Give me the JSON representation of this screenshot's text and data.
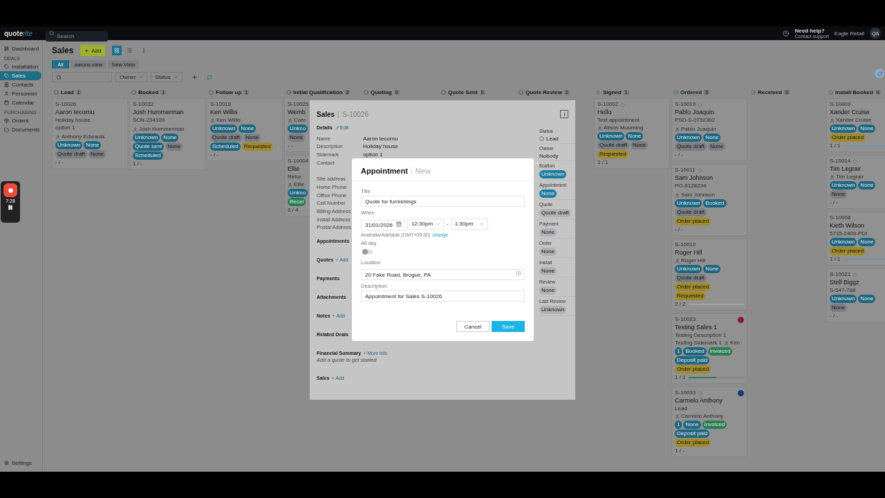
{
  "topbar": {
    "brand": [
      "quote",
      "rite"
    ],
    "search": {
      "placeholder": "Search"
    },
    "help": {
      "title": "Need help?",
      "subtitle": "Contact support"
    },
    "company": "Eagle Retail",
    "avatar": "QA"
  },
  "sidebar": {
    "groups": [
      {
        "items": [
          {
            "label": "Dashboard",
            "selected": false
          }
        ]
      },
      {
        "heading": "DEALS",
        "items": [
          {
            "label": "Installation",
            "selected": false
          },
          {
            "label": "Sales",
            "selected": true
          },
          {
            "label": "Contacts",
            "selected": false
          },
          {
            "label": "Personnel",
            "selected": false
          },
          {
            "label": "Calendar",
            "selected": false
          }
        ]
      },
      {
        "heading": "PURCHASING",
        "items": [
          {
            "label": "Orders",
            "selected": false
          },
          {
            "label": "Documents",
            "selected": false
          }
        ]
      }
    ],
    "footer": "Settings"
  },
  "recorder": {
    "time": "7:28"
  },
  "page": {
    "title": "Sales",
    "add_button": "Add",
    "layouts": [
      {
        "kind": "board",
        "selected": true
      },
      {
        "kind": "list",
        "selected": false
      }
    ],
    "views": [
      {
        "label": "All",
        "selected": true
      },
      {
        "label": "aarons view",
        "selected": false
      },
      {
        "label": "New View",
        "selected": false
      }
    ],
    "filters": [
      {
        "label": "Owner"
      },
      {
        "label": "Status"
      }
    ]
  },
  "columns": [
    {
      "title": "Lead",
      "count": "1",
      "kind": "open",
      "cards": [
        {
          "id": "S-10026",
          "name": "Aaron Iecornu",
          "description": "Holiday house",
          "reference": "option 1",
          "contact": "Anthony Edwards",
          "tags": [
            [
              {
                "text": "Unknown",
                "color": "#1d6680"
              },
              {
                "text": "None",
                "color": "#1d6680"
              }
            ],
            [
              {
                "text": "Quote draft",
                "color": "#7b7e82"
              },
              {
                "text": "None",
                "color": "#7b7e82"
              }
            ]
          ],
          "footer": "- / -"
        }
      ]
    },
    {
      "title": "Booked",
      "count": "1",
      "kind": "open",
      "cards": [
        {
          "id": "S-10032",
          "name": "Josh Hummerman",
          "reference": "SCN-234100",
          "contact": "Josh Hummerman",
          "tags": [
            [
              {
                "text": "Unknown",
                "color": "#1d6680"
              },
              {
                "text": "None",
                "color": "#1d6680"
              }
            ],
            [
              {
                "text": "Quote sent",
                "color": "#1d6680"
              },
              {
                "text": "None",
                "color": "#7b7e82"
              }
            ],
            [
              {
                "text": "Scheduled",
                "color": "#1d6680"
              }
            ]
          ],
          "footer": "1 / -"
        }
      ]
    },
    {
      "title": "Follow up",
      "count": "1",
      "kind": "open",
      "cards": [
        {
          "id": "S-10018",
          "name": "Ken Willis",
          "contact": "Ken Willis",
          "tags": [
            [
              {
                "text": "Unknown",
                "color": "#1d6680"
              },
              {
                "text": "None",
                "color": "#1d6680"
              }
            ],
            [
              {
                "text": "Quote draft",
                "color": "#7b7e82"
              },
              {
                "text": "None",
                "color": "#7b7e82"
              }
            ],
            [
              {
                "text": "Scheduled",
                "color": "#1d6680"
              },
              {
                "text": "Requested",
                "color": "#a08a2a"
              }
            ]
          ],
          "footer": "- / -"
        }
      ]
    },
    {
      "title": "Initial Qualification",
      "count": "2",
      "kind": "open",
      "cards": [
        {
          "id": "S-10025",
          "name": "Wemb",
          "contact": "Com",
          "tags": [
            [
              {
                "text": "Unkno",
                "color": "#1d6680"
              }
            ],
            [
              {
                "text": "None",
                "color": "#7b7e82"
              }
            ]
          ],
          "footer": "- -"
        },
        {
          "id": "S-10004",
          "name": "Ellie",
          "description": "Refur",
          "contact": "Ellie",
          "tags": [
            [
              {
                "text": "Unkno",
                "color": "#1d6680"
              }
            ],
            [
              {
                "text": "Recei",
                "color": "#2a7d52"
              }
            ]
          ],
          "footer": "6 / 4"
        }
      ]
    },
    {
      "title": "Quoting",
      "count": "0",
      "kind": "open"
    },
    {
      "title": "Quote Sent",
      "count": "0",
      "kind": "open"
    },
    {
      "title": "Quote Review",
      "count": "2",
      "kind": "open"
    },
    {
      "title": "Signed",
      "count": "1",
      "kind": "signed",
      "cards": [
        {
          "id": "S-10002",
          "diamond": true,
          "name": "Hello",
          "description": "Test appointment",
          "contact": "Alison Mourning",
          "tags": [
            [
              {
                "text": "Unknown",
                "color": "#1d6680"
              },
              {
                "text": "None",
                "color": "#1d6680"
              }
            ],
            [
              {
                "text": "Quote draft",
                "color": "#7b7e82"
              },
              {
                "text": "None",
                "color": "#7b7e82"
              }
            ],
            [
              {
                "text": "Requested",
                "color": "#a08a2a"
              }
            ]
          ],
          "footer": "1 / 1"
        }
      ]
    },
    {
      "title": "Ordered",
      "count": "5",
      "kind": "progress",
      "cards": [
        {
          "id": "S-10019",
          "diamond": true,
          "name": "Pablo Joaquin",
          "reference": "PSD-S-0752302",
          "contact": "Pablo Joaquin",
          "tags": [
            [
              {
                "text": "Unknown",
                "color": "#1d6680"
              },
              {
                "text": "None",
                "color": "#1d6680"
              }
            ],
            [
              {
                "text": "Quote draft",
                "color": "#7b7e82"
              },
              {
                "text": "None",
                "color": "#7b7e82"
              }
            ]
          ],
          "footer": "- / -"
        },
        {
          "id": "S-10011",
          "diamond": true,
          "name": "Sam Johnson",
          "reference": "PO-8128234",
          "contact": "Sam Johnson",
          "tags": [
            [
              {
                "text": "Unknown",
                "color": "#1d6680"
              },
              {
                "text": "Booked",
                "color": "#1d6680"
              }
            ],
            [
              {
                "text": "Quote draft",
                "color": "#7b7e82"
              }
            ],
            [
              {
                "text": "Order placed",
                "color": "#a08a2a"
              }
            ]
          ],
          "footer": "- / -"
        },
        {
          "id": "S-10010",
          "name": "Roger Hill",
          "contact": "Roger Hill",
          "tags": [
            [
              {
                "text": "Unknown",
                "color": "#1d6680"
              },
              {
                "text": "None",
                "color": "#1d6680"
              }
            ],
            [
              {
                "text": "Quote draft",
                "color": "#7b7e82"
              }
            ],
            [
              {
                "text": "Order placed",
                "color": "#a08a2a"
              }
            ],
            [
              {
                "text": "Requested",
                "color": "#a08a2a"
              }
            ]
          ],
          "footer": "2 / 2",
          "progress": {
            "level": 1,
            "color": "#a3a5a8"
          }
        },
        {
          "id": "S-10023",
          "name": "Testing Sales 1",
          "avatar": {
            "color": "#8c1a36"
          },
          "description": "Testing Description 1",
          "reference": "Testing Sidemark 1",
          "contact": "Kim",
          "tags": [
            [
              {
                "text": "1",
                "color": "#1d6680"
              },
              {
                "text": "Booked",
                "color": "#1d6680"
              },
              {
                "text": "Invoiced",
                "color": "#2a7d52"
              }
            ],
            [
              {
                "text": "Deposit paid",
                "color": "#1d6680"
              }
            ],
            [
              {
                "text": "Order placed",
                "color": "#a08a2a"
              }
            ]
          ],
          "footer": "1 / 1",
          "progress": {
            "level": 0.5,
            "color": "#2c7d4f"
          }
        },
        {
          "id": "S-10033",
          "diamond": true,
          "name": "Carmelo Anthony",
          "avatar": {
            "color": "#163a7a"
          },
          "description": "Lead",
          "contact": "Carmelo Anthony",
          "tags": [
            [
              {
                "text": "1",
                "color": "#1d6680"
              },
              {
                "text": "None",
                "color": "#1d6680"
              },
              {
                "text": "Invoiced",
                "color": "#2a7d52"
              }
            ],
            [
              {
                "text": "Deposit paid",
                "color": "#1d6680"
              }
            ],
            [
              {
                "text": "Order placed",
                "color": "#a08a2a"
              }
            ]
          ],
          "footer": "1 / -"
        }
      ]
    },
    {
      "title": "Received",
      "count": "0",
      "kind": "progress"
    },
    {
      "title": "Install Booked",
      "count": "4",
      "kind": "progress",
      "cards": [
        {
          "id": "S-10009",
          "name": "Xander Cruise",
          "contact": "Xander Cruise",
          "tags": [
            [
              {
                "text": "Unknown",
                "color": "#1d6680"
              },
              {
                "text": "None",
                "color": "#1d6680"
              }
            ],
            [
              {
                "text": "Order placed",
                "color": "#a08a2a"
              }
            ]
          ],
          "footer": "1 / 1",
          "progress": {
            "level": 1,
            "color": "#6d97a6"
          }
        },
        {
          "id": "S-10014",
          "diamond": true,
          "name": "Tim Legrair",
          "contact": "Tim Legrair",
          "tags": [
            [
              {
                "text": "Unknown",
                "color": "#1d6680"
              },
              {
                "text": "None",
                "color": "#1d6680"
              }
            ],
            [
              {
                "text": "None",
                "color": "#7b7e82"
              }
            ]
          ],
          "footer": "- / -"
        },
        {
          "id": "S-10008",
          "name": "Kieth Wilson",
          "reference": "5715-2409-PDI",
          "tags": [
            [
              {
                "text": "Unknown",
                "color": "#1d6680"
              },
              {
                "text": "None",
                "color": "#1d6680"
              }
            ],
            [
              {
                "text": "Order placed",
                "color": "#a08a2a"
              }
            ]
          ],
          "footer": "1 / 1",
          "progress": {
            "level": 1,
            "color": "#6d97a6"
          }
        },
        {
          "id": "S-10021",
          "diamond": true,
          "name": "Stell Biggz",
          "reference": "S-547-788",
          "tags": [
            [
              {
                "text": "Unknown",
                "color": "#1d6680"
              },
              {
                "text": "None",
                "color": "#1d6680"
              }
            ],
            [
              {
                "text": "None",
                "color": "#7b7e82"
              }
            ]
          ],
          "footer": "- / -"
        }
      ]
    }
  ],
  "sales_panel": {
    "title": "Sales",
    "id": "S-10026",
    "details": {
      "title": "Details",
      "action": "Edit"
    },
    "fields": [
      {
        "label": "Name",
        "value": "Aaron Iecornu"
      },
      {
        "label": "Description",
        "value": "Holiday house"
      },
      {
        "label": "Sidemark",
        "value": "option 1"
      },
      {
        "label": "Contact"
      }
    ],
    "addresses": [
      "Site address",
      "Home Phone",
      "Office Phone",
      "Cell Number",
      "Billing Address",
      "Install Address",
      "Postal Address"
    ],
    "sections": [
      {
        "title": "Appointments"
      },
      {
        "title": "Quotes",
        "action": "Add"
      },
      {
        "title": "Payments"
      },
      {
        "title": "Attachments"
      },
      {
        "title": "Notes",
        "action": "Add"
      },
      {
        "title": "Related Deals"
      },
      {
        "title": "Financial Summary",
        "action": "More info",
        "hint": "Add a quote to get started"
      },
      {
        "title": "Sales",
        "action": "Add"
      }
    ],
    "meta": [
      {
        "label": "Status",
        "value": "Lead",
        "kind": "radio"
      },
      {
        "label": "Owner",
        "value": "Nobody",
        "kind": "text"
      },
      {
        "label": "fication",
        "value": "Unknown",
        "kind": "chip",
        "color": "#1a7da0"
      },
      {
        "label": "Appointment",
        "value": "None",
        "kind": "chip",
        "color": "#1a7da0"
      },
      {
        "label": "Quote",
        "value": "Quote draft",
        "kind": "chip",
        "color": "#b0b2b5"
      },
      {
        "label": "Payment",
        "value": "None",
        "kind": "chip",
        "color": "#b0b2b5"
      },
      {
        "label": "Order",
        "value": "None",
        "kind": "chip",
        "color": "#b0b2b5"
      },
      {
        "label": "Install",
        "value": "None",
        "kind": "chip",
        "color": "#b0b2b5"
      },
      {
        "label": "Review",
        "value": "None",
        "kind": "chip",
        "color": "#b0b2b5"
      },
      {
        "label": "Last Review",
        "value": "Unknown",
        "kind": "chip",
        "color": "#b0b2b5"
      }
    ]
  },
  "appointment": {
    "title": "Appointment",
    "subtitle": "New",
    "title_field": {
      "label": "Title",
      "value": "Quote for furnishings"
    },
    "when": {
      "label": "When",
      "date": "31/01/2026",
      "start": "12:30pm",
      "separator": "-",
      "end": "1:30pm",
      "timezone": "Australia/Adelaide (GMT+09:30)",
      "timezone_action": "change"
    },
    "all_day": {
      "label": "All day",
      "on": false
    },
    "location": {
      "label": "Location",
      "value": "20 Fake Road, Brogue, PA"
    },
    "description": {
      "label": "Description",
      "value": "Appointment for Sales S-10026"
    },
    "buttons": {
      "cancel": "Cancel",
      "save": "Save"
    }
  }
}
